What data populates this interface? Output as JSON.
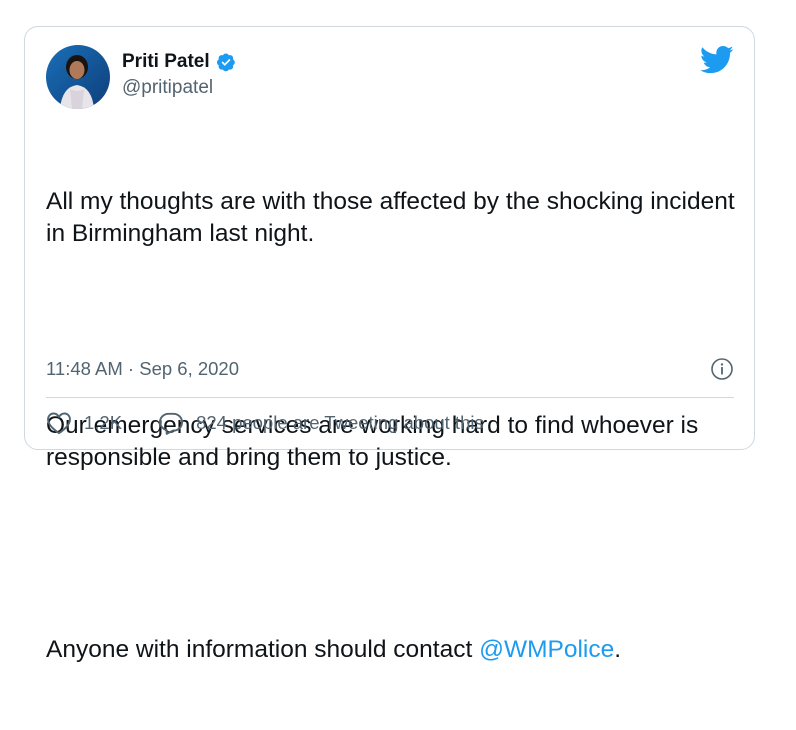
{
  "author": {
    "display_name": "Priti Patel",
    "handle": "@pritipatel",
    "verified": true
  },
  "tweet": {
    "paragraph_1": "All my thoughts are with those affected by the shocking incident in Birmingham last night.",
    "paragraph_2": "Our emergency services are working hard to find whoever is responsible and bring them to justice.",
    "paragraph_3_text": "Anyone with information should contact ",
    "paragraph_3_mention": "@WMPolice",
    "paragraph_3_end": "."
  },
  "meta": {
    "timestamp": "11:48 AM · Sep 6, 2020"
  },
  "actions": {
    "likes": "1.2K",
    "conversation": "824 people are Tweeting about this"
  },
  "colors": {
    "accent": "#1d9bf0",
    "text": "#0f1419",
    "secondary_text": "#536471",
    "border": "#cfd9de"
  },
  "icons": [
    "verified-badge-icon",
    "twitter-bird-icon",
    "info-icon",
    "heart-icon",
    "reply-bubble-icon"
  ]
}
